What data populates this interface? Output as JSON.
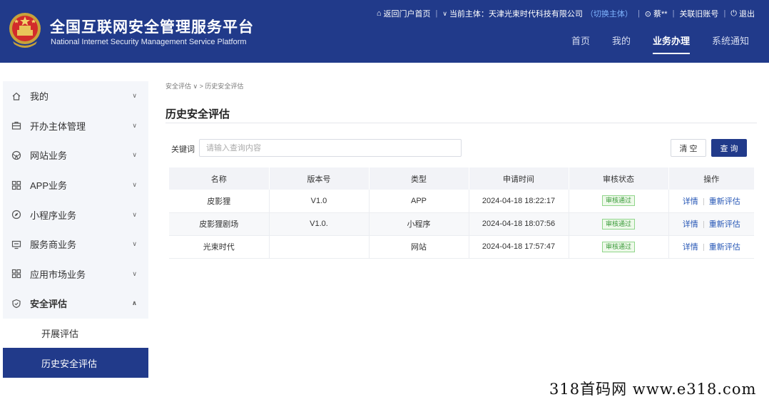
{
  "header": {
    "title": "全国互联网安全管理服务平台",
    "subtitle": "National Internet Security Management Service Platform",
    "topbar": {
      "home_link": "返回门户首页",
      "entity_prefix": "当前主体：",
      "entity_name": "天津光束时代科技有限公司",
      "switch_entity": "（切换主体）",
      "user": "蔡**",
      "link_account": "关联旧账号",
      "logout": "退出"
    },
    "nav": [
      "首页",
      "我的",
      "业务办理",
      "系统通知"
    ],
    "active_nav": "业务办理"
  },
  "sidebar": {
    "items": [
      {
        "label": "我的",
        "icon": "home-icon"
      },
      {
        "label": "开办主体管理",
        "icon": "briefcase-icon"
      },
      {
        "label": "网站业务",
        "icon": "globe-icon"
      },
      {
        "label": "APP业务",
        "icon": "grid-icon"
      },
      {
        "label": "小程序业务",
        "icon": "compass-icon"
      },
      {
        "label": "服务商业务",
        "icon": "monitor-icon"
      },
      {
        "label": "应用市场业务",
        "icon": "grid-icon"
      },
      {
        "label": "安全评估",
        "icon": "shield-icon"
      }
    ],
    "sub_items": [
      "开展评估",
      "历史安全评估"
    ],
    "active_sub": "历史安全评估"
  },
  "breadcrumb": {
    "first": "安全评估",
    "second": "历史安全评估"
  },
  "page_title": "历史安全评估",
  "search": {
    "label": "关键词",
    "placeholder": "请输入查询内容",
    "value": ""
  },
  "buttons": {
    "clear": "清 空",
    "query": "查 询"
  },
  "table": {
    "columns": [
      "名称",
      "版本号",
      "类型",
      "申请时间",
      "审核状态",
      "操作"
    ],
    "rows": [
      {
        "name": "皮影狸",
        "version": "V1.0",
        "type": "APP",
        "time": "2024-04-18 18:22:17",
        "status": "审核通过",
        "detail": "详情",
        "reassess": "重新评估"
      },
      {
        "name": "皮影狸剧场",
        "version": "V1.0.",
        "type": "小程序",
        "time": "2024-04-18 18:07:56",
        "status": "审核通过",
        "detail": "详情",
        "reassess": "重新评估"
      },
      {
        "name": "光束时代",
        "version": "",
        "type": "网站",
        "time": "2024-04-18 17:57:47",
        "status": "审核通过",
        "detail": "详情",
        "reassess": "重新评估"
      }
    ]
  },
  "watermark": "318首码网  www.e318.com",
  "colors": {
    "primary": "#213a8a",
    "link": "#2455b5",
    "success": "#3a9b3a"
  }
}
